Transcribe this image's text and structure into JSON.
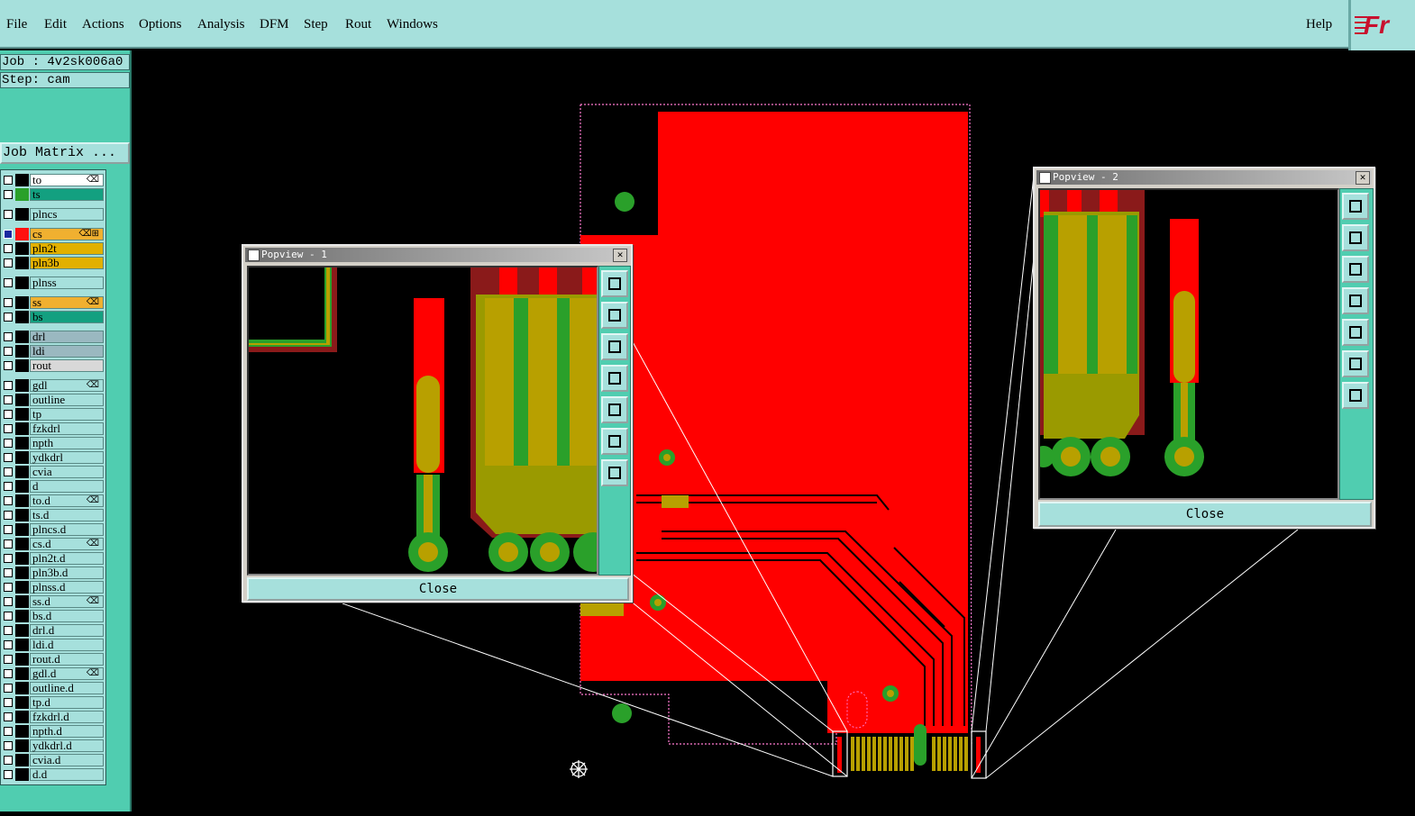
{
  "menubar": {
    "items": [
      "File",
      "Edit",
      "Actions",
      "Options",
      "Analysis",
      "DFM",
      "Step",
      "Rout",
      "Windows"
    ],
    "help": "Help",
    "logo": "Fr"
  },
  "job": {
    "label": "Job : 4v2sk006a0",
    "step": "Step: cam",
    "matrix_button": "Job Matrix ..."
  },
  "layers": [
    {
      "name": "to",
      "color": "#ffffff",
      "swatch": "#000000",
      "mark": "⌫"
    },
    {
      "name": "ts",
      "color": "#13a080",
      "swatch": "#2aa02a",
      "mark": ""
    },
    {
      "name": "plncs",
      "color": "#a6e0dc",
      "swatch": "#000000",
      "mark": ""
    },
    {
      "name": "cs",
      "color": "#f0b030",
      "swatch": "#ff1010",
      "mark": "⌫⊞",
      "selected": true
    },
    {
      "name": "pln2t",
      "color": "#e2b000",
      "swatch": "#000000",
      "mark": ""
    },
    {
      "name": "pln3b",
      "color": "#e2b000",
      "swatch": "#000000",
      "mark": ""
    },
    {
      "name": "plnss",
      "color": "#a6e0dc",
      "swatch": "#000000",
      "mark": ""
    },
    {
      "name": "ss",
      "color": "#f0b030",
      "swatch": "#000000",
      "mark": "⌫"
    },
    {
      "name": "bs",
      "color": "#13a080",
      "swatch": "#000000",
      "mark": ""
    },
    {
      "name": "drl",
      "color": "#9ab8c0",
      "swatch": "#000000",
      "mark": ""
    },
    {
      "name": "ldi",
      "color": "#9ab8c0",
      "swatch": "#000000",
      "mark": ""
    },
    {
      "name": "rout",
      "color": "#d8d8d8",
      "swatch": "#000000",
      "mark": ""
    },
    {
      "name": "gdl",
      "color": "#a6e0dc",
      "swatch": "#000000",
      "mark": "⌫"
    },
    {
      "name": "outline",
      "color": "#a6e0dc",
      "swatch": "#000000",
      "mark": ""
    },
    {
      "name": "tp",
      "color": "#a6e0dc",
      "swatch": "#000000",
      "mark": ""
    },
    {
      "name": "fzkdrl",
      "color": "#a6e0dc",
      "swatch": "#000000",
      "mark": ""
    },
    {
      "name": "npth",
      "color": "#a6e0dc",
      "swatch": "#000000",
      "mark": ""
    },
    {
      "name": "ydkdrl",
      "color": "#a6e0dc",
      "swatch": "#000000",
      "mark": ""
    },
    {
      "name": "cvia",
      "color": "#a6e0dc",
      "swatch": "#000000",
      "mark": ""
    },
    {
      "name": "d",
      "color": "#a6e0dc",
      "swatch": "#000000",
      "mark": ""
    },
    {
      "name": "to.d",
      "color": "#a6e0dc",
      "swatch": "#000000",
      "mark": "⌫"
    },
    {
      "name": "ts.d",
      "color": "#a6e0dc",
      "swatch": "#000000",
      "mark": ""
    },
    {
      "name": "plncs.d",
      "color": "#a6e0dc",
      "swatch": "#000000",
      "mark": ""
    },
    {
      "name": "cs.d",
      "color": "#a6e0dc",
      "swatch": "#000000",
      "mark": "⌫"
    },
    {
      "name": "pln2t.d",
      "color": "#a6e0dc",
      "swatch": "#000000",
      "mark": ""
    },
    {
      "name": "pln3b.d",
      "color": "#a6e0dc",
      "swatch": "#000000",
      "mark": ""
    },
    {
      "name": "plnss.d",
      "color": "#a6e0dc",
      "swatch": "#000000",
      "mark": ""
    },
    {
      "name": "ss.d",
      "color": "#a6e0dc",
      "swatch": "#000000",
      "mark": "⌫"
    },
    {
      "name": "bs.d",
      "color": "#a6e0dc",
      "swatch": "#000000",
      "mark": ""
    },
    {
      "name": "drl.d",
      "color": "#a6e0dc",
      "swatch": "#000000",
      "mark": ""
    },
    {
      "name": "ldi.d",
      "color": "#a6e0dc",
      "swatch": "#000000",
      "mark": ""
    },
    {
      "name": "rout.d",
      "color": "#a6e0dc",
      "swatch": "#000000",
      "mark": ""
    },
    {
      "name": "gdl.d",
      "color": "#a6e0dc",
      "swatch": "#000000",
      "mark": "⌫"
    },
    {
      "name": "outline.d",
      "color": "#a6e0dc",
      "swatch": "#000000",
      "mark": ""
    },
    {
      "name": "tp.d",
      "color": "#a6e0dc",
      "swatch": "#000000",
      "mark": ""
    },
    {
      "name": "fzkdrl.d",
      "color": "#a6e0dc",
      "swatch": "#000000",
      "mark": ""
    },
    {
      "name": "npth.d",
      "color": "#a6e0dc",
      "swatch": "#000000",
      "mark": ""
    },
    {
      "name": "ydkdrl.d",
      "color": "#a6e0dc",
      "swatch": "#000000",
      "mark": ""
    },
    {
      "name": "cvia.d",
      "color": "#a6e0dc",
      "swatch": "#000000",
      "mark": ""
    },
    {
      "name": "d.d",
      "color": "#a6e0dc",
      "swatch": "#000000",
      "mark": ""
    }
  ],
  "popview1": {
    "title": "Popview - 1",
    "close": "Close"
  },
  "popview2": {
    "title": "Popview - 2",
    "close": "Close"
  },
  "colors": {
    "copper": "#ff0000",
    "mask": "#2aa02a",
    "silk": "#b8a000",
    "panel": "#50cdb0",
    "menu": "#a6e0dc"
  },
  "icons": [
    "zoom-fit-icon",
    "pan-up-icon",
    "pan-down-icon",
    "pan-left-icon",
    "pan-right-icon",
    "zoom-in-icon",
    "zoom-out-icon"
  ]
}
